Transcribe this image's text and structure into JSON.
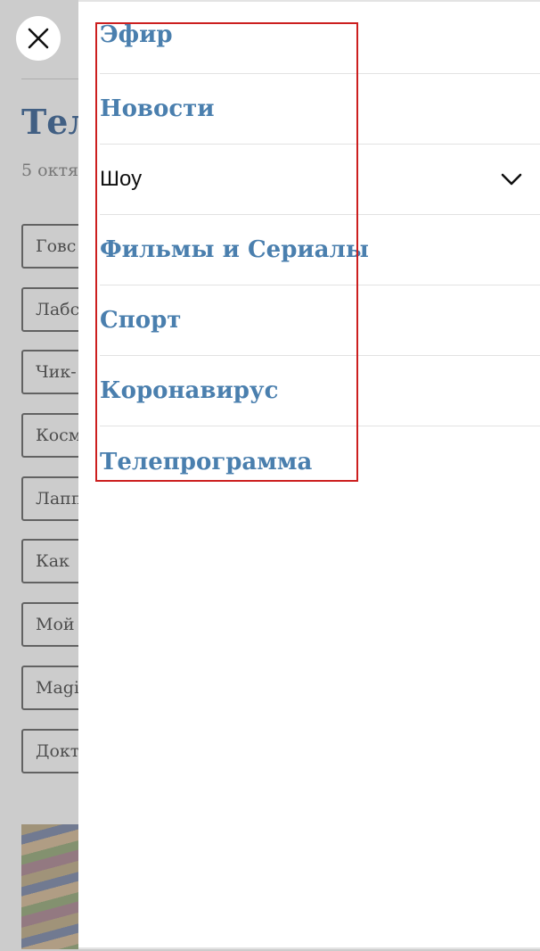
{
  "background": {
    "title": "Тел",
    "date": "5 октя",
    "tags": [
      "Говс",
      "Лабс",
      "Чик-",
      "Косм",
      "Лапп",
      "Как",
      "Мой",
      "Magi",
      "Докт"
    ]
  },
  "close_icon": "close-icon",
  "menu": {
    "items": [
      {
        "label": "Эфир"
      },
      {
        "label": "Новости"
      },
      {
        "label": "Шоу",
        "has_submenu": true
      },
      {
        "label": "Фильмы и Сериалы"
      },
      {
        "label": "Спорт"
      },
      {
        "label": "Коронавирус"
      },
      {
        "label": "Телепрограмма"
      }
    ]
  },
  "colors": {
    "link": "#4a7fae",
    "title": "#1f4f8a",
    "highlight": "#cc1f1f"
  }
}
